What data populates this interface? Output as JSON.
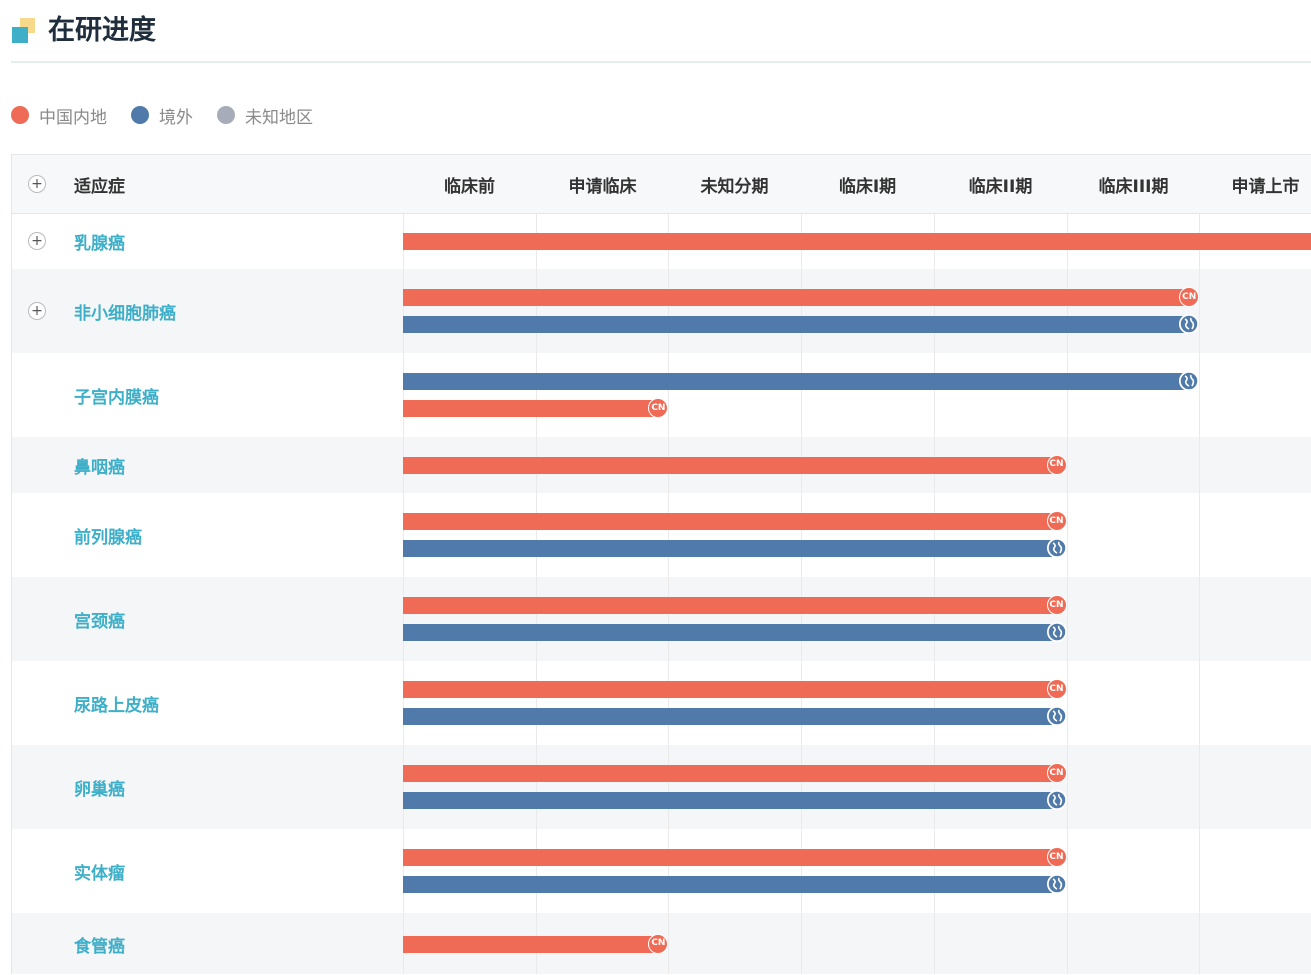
{
  "header": {
    "title": "在研进度"
  },
  "legend": [
    {
      "label": "中国内地",
      "color": "#ef6b55"
    },
    {
      "label": "境外",
      "color": "#4f7aa9"
    },
    {
      "label": "未知地区",
      "color": "#a7adb8"
    }
  ],
  "table": {
    "indication_header": "适应症",
    "stage_headers": [
      "临床前",
      "申请临床",
      "未知分期",
      "临床I期",
      "临床II期",
      "临床III期",
      "申请上市"
    ],
    "rows": [
      {
        "name": "乳腺癌",
        "expandable": true,
        "alt": false,
        "bars": [
          {
            "region": "cn",
            "stage": 7
          }
        ]
      },
      {
        "name": "非小细胞肺癌",
        "expandable": true,
        "alt": true,
        "bars": [
          {
            "region": "cn",
            "stage": 6
          },
          {
            "region": "os",
            "stage": 6
          }
        ]
      },
      {
        "name": "子宫内膜癌",
        "expandable": false,
        "alt": false,
        "bars": [
          {
            "region": "os",
            "stage": 6
          },
          {
            "region": "cn",
            "stage": 2
          }
        ]
      },
      {
        "name": "鼻咽癌",
        "expandable": false,
        "alt": true,
        "bars": [
          {
            "region": "cn",
            "stage": 5
          }
        ]
      },
      {
        "name": "前列腺癌",
        "expandable": false,
        "alt": false,
        "bars": [
          {
            "region": "cn",
            "stage": 5
          },
          {
            "region": "os",
            "stage": 5
          }
        ]
      },
      {
        "name": "宫颈癌",
        "expandable": false,
        "alt": true,
        "bars": [
          {
            "region": "cn",
            "stage": 5
          },
          {
            "region": "os",
            "stage": 5
          }
        ]
      },
      {
        "name": "尿路上皮癌",
        "expandable": false,
        "alt": false,
        "bars": [
          {
            "region": "cn",
            "stage": 5
          },
          {
            "region": "os",
            "stage": 5
          }
        ]
      },
      {
        "name": "卵巢癌",
        "expandable": false,
        "alt": true,
        "bars": [
          {
            "region": "cn",
            "stage": 5
          },
          {
            "region": "os",
            "stage": 5
          }
        ]
      },
      {
        "name": "实体瘤",
        "expandable": false,
        "alt": false,
        "bars": [
          {
            "region": "cn",
            "stage": 5
          },
          {
            "region": "os",
            "stage": 5
          }
        ]
      },
      {
        "name": "食管癌",
        "expandable": false,
        "alt": true,
        "bars": [
          {
            "region": "cn",
            "stage": 2
          }
        ]
      }
    ]
  },
  "marker_labels": {
    "cn": "CN"
  },
  "icons": {
    "expand": "plus-icon",
    "overseas": "globe-icon",
    "cn": "cn-badge-icon"
  }
}
